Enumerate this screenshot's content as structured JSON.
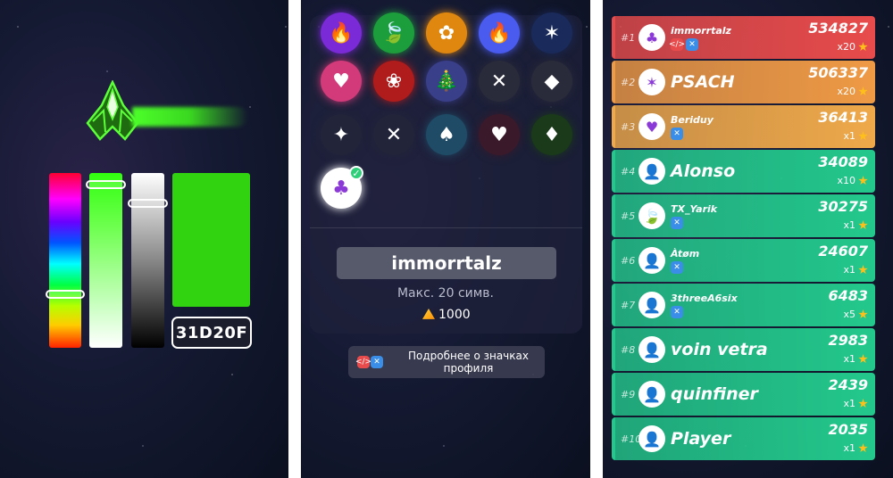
{
  "color_picker": {
    "hex_value": "31D20F",
    "current_color": "#31D20F"
  },
  "profile": {
    "icons": [
      {
        "name": "flame-icon",
        "glyph": "🔥",
        "bg": "#7a2ad6"
      },
      {
        "name": "leaf-icon",
        "glyph": "🍃",
        "bg": "#1d9e3c"
      },
      {
        "name": "flower-icon",
        "glyph": "✿",
        "bg": "#e0870f"
      },
      {
        "name": "fire-blue-icon",
        "glyph": "🔥",
        "bg": "#4a5cf0"
      },
      {
        "name": "star-blue-icon",
        "glyph": "✶",
        "bg": "#1a2a5a"
      },
      {
        "name": "heart-pattern-icon",
        "glyph": "♥",
        "bg": "#d23a7a"
      },
      {
        "name": "wreath-icon",
        "glyph": "❀",
        "bg": "#b01c1c"
      },
      {
        "name": "snowglobe-icon",
        "glyph": "🎄",
        "bg": "#3a3f8a"
      },
      {
        "name": "crossed-swords-icon",
        "glyph": "✕",
        "bg": "#2a2b3a"
      },
      {
        "name": "crystal-icon",
        "glyph": "◆",
        "bg": "#2a2b3a"
      },
      {
        "name": "sparkle-icon",
        "glyph": "✦",
        "bg": "#22243a"
      },
      {
        "name": "x-cross-icon",
        "glyph": "✕",
        "bg": "#22243a"
      },
      {
        "name": "spade-icon",
        "glyph": "♠",
        "bg": "#1f4b66"
      },
      {
        "name": "heart-icon",
        "glyph": "♥",
        "bg": "#3a1a2a"
      },
      {
        "name": "diamond-icon",
        "glyph": "♦",
        "bg": "#1a3a1a"
      },
      {
        "name": "club-icon",
        "glyph": "♣",
        "bg": "#ffffff",
        "selected": true
      }
    ],
    "player_name": "immorrtalz",
    "max_chars_hint": "Макс. 20 симв.",
    "cost": "1000",
    "info_button": "Подробнее о значках профиля"
  },
  "leaderboard": [
    {
      "rank": "#1",
      "name": "immorrtalz",
      "score": "534827",
      "mult": "x20",
      "color": "#e84b4b",
      "avatar": "♣",
      "badges": [
        "</>",
        "✕"
      ]
    },
    {
      "rank": "#2",
      "name": "PSACH",
      "score": "506337",
      "mult": "x20",
      "color": "#ef9a45",
      "avatar": "✶",
      "badges": []
    },
    {
      "rank": "#3",
      "name": "Beriduy",
      "score": "36413",
      "mult": "x1",
      "color": "#efa94a",
      "avatar": "♥",
      "badges": [
        "✕"
      ]
    },
    {
      "rank": "#4",
      "name": "Alonso",
      "score": "34089",
      "mult": "x10",
      "color": "#23c88c",
      "avatar": "👤",
      "badges": []
    },
    {
      "rank": "#5",
      "name": "TX_Yarik",
      "score": "30275",
      "mult": "x1",
      "color": "#23c88c",
      "avatar": "🍃",
      "badges": [
        "✕"
      ]
    },
    {
      "rank": "#6",
      "name": "Àtøm",
      "score": "24607",
      "mult": "x1",
      "color": "#23c88c",
      "avatar": "👤",
      "badges": [
        "✕"
      ]
    },
    {
      "rank": "#7",
      "name": "3threeA6six",
      "score": "6483",
      "mult": "x5",
      "color": "#23c88c",
      "avatar": "👤",
      "badges": [
        "✕"
      ]
    },
    {
      "rank": "#8",
      "name": "voin vetra",
      "score": "2983",
      "mult": "x1",
      "color": "#23c88c",
      "avatar": "👤",
      "badges": []
    },
    {
      "rank": "#9",
      "name": "quinfiner",
      "score": "2439",
      "mult": "x1",
      "color": "#23c88c",
      "avatar": "👤",
      "badges": []
    },
    {
      "rank": "#10",
      "name": "Player",
      "score": "2035",
      "mult": "x1",
      "color": "#23c88c",
      "avatar": "👤",
      "badges": []
    }
  ]
}
